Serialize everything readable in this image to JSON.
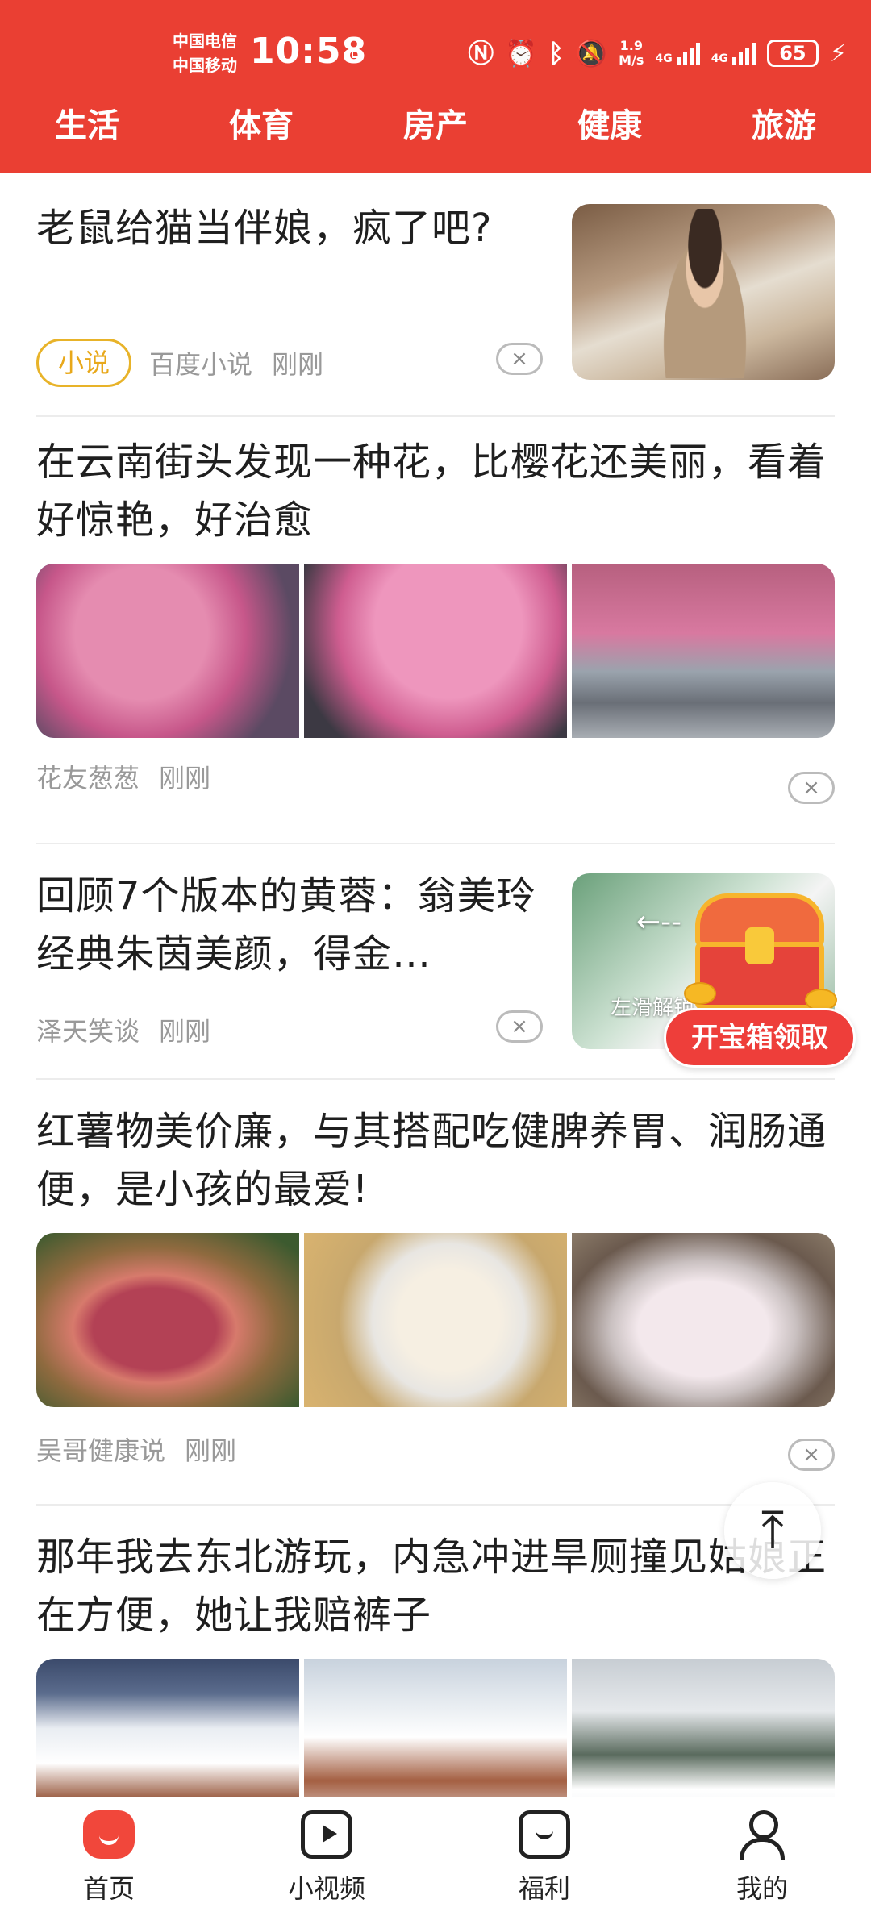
{
  "status_bar": {
    "carrier_1": "中国电信",
    "carrier_2": "中国移动",
    "time": "10:58",
    "net_speed_value": "1.9",
    "net_speed_unit": "M/s",
    "signal_1_label": "4G",
    "signal_2_label": "4G",
    "battery": "65"
  },
  "tabs": [
    {
      "label": "生活",
      "active": true
    },
    {
      "label": "体育",
      "active": false
    },
    {
      "label": "房产",
      "active": false
    },
    {
      "label": "健康",
      "active": false
    },
    {
      "label": "旅游",
      "active": false
    }
  ],
  "feed": {
    "articles": [
      {
        "title": "老鼠给猫当伴娘，疯了吧?",
        "tag": "小说",
        "source": "百度小说",
        "time": "刚刚",
        "close": "×"
      },
      {
        "title": "在云南街头发现一种花，比樱花还美丽，看着好惊艳，好治愈",
        "source": "花友葱葱",
        "time": "刚刚",
        "close": "×"
      },
      {
        "title": "回顾7个版本的黄蓉：翁美玲经典朱茵美颜，得金…",
        "source": "泽天笑谈",
        "time": "刚刚",
        "close": "×",
        "thumb_hint": "左滑解锁"
      },
      {
        "title": "红薯物美价廉，与其搭配吃健脾养胃、润肠通便，是小孩的最爱!",
        "source": "吴哥健康说",
        "time": "刚刚",
        "close": "×"
      },
      {
        "title": "那年我去东北游玩，内急冲进旱厕撞见姑娘正在方便，她让我赔裤子"
      }
    ]
  },
  "treasure": {
    "label": "开宝箱领取"
  },
  "back_to_top": {
    "icon": "arrow-up-icon"
  },
  "bottom_nav": {
    "items": [
      {
        "label": "首页",
        "icon": "home-icon"
      },
      {
        "label": "小视频",
        "icon": "video-icon"
      },
      {
        "label": "福利",
        "icon": "gift-icon"
      },
      {
        "label": "我的",
        "icon": "user-icon"
      }
    ]
  },
  "colors": {
    "brand": "#ea3f33",
    "tag": "#e8b329"
  }
}
